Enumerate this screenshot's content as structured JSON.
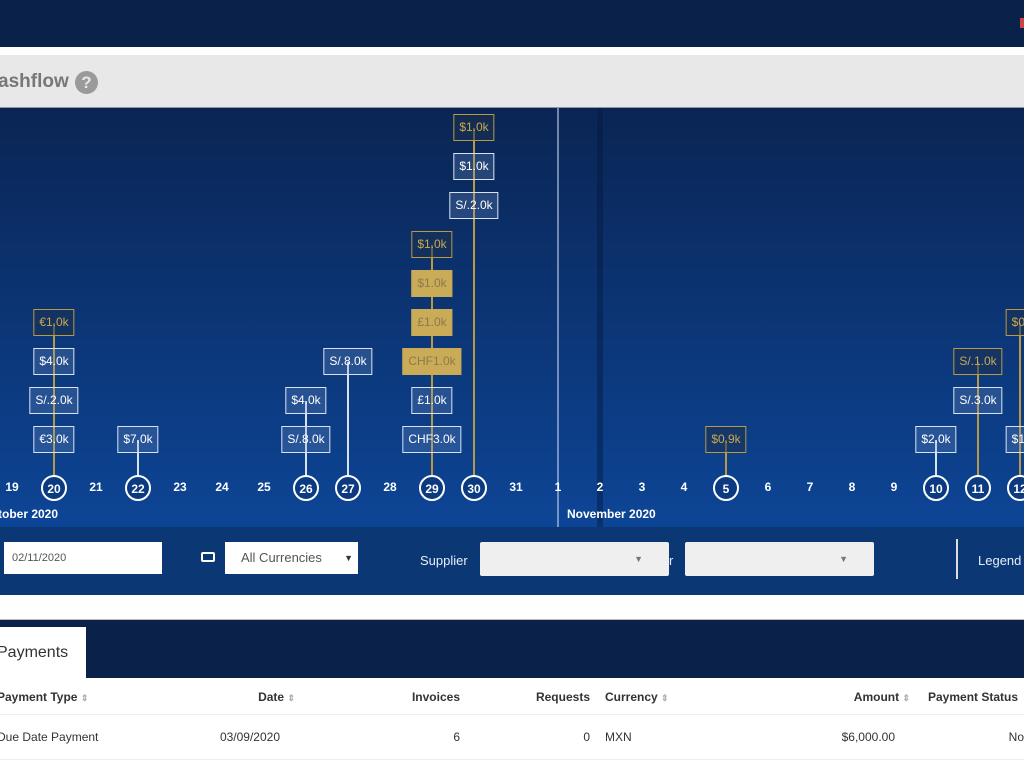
{
  "header": {
    "title": "ashflow",
    "help_icon": "?"
  },
  "colors": {
    "navy": "#0a2149",
    "gold": "#c9ab58",
    "filter_bg": "#0b3775"
  },
  "timeline": {
    "months": [
      {
        "label": "tober 2020"
      },
      {
        "label": "November 2020"
      }
    ],
    "days": [
      {
        "label": "19",
        "has": false
      },
      {
        "label": "20",
        "has": true
      },
      {
        "label": "21",
        "has": false
      },
      {
        "label": "22",
        "has": true
      },
      {
        "label": "23",
        "has": false
      },
      {
        "label": "24",
        "has": false
      },
      {
        "label": "25",
        "has": false
      },
      {
        "label": "26",
        "has": true
      },
      {
        "label": "27",
        "has": true
      },
      {
        "label": "28",
        "has": false
      },
      {
        "label": "29",
        "has": true
      },
      {
        "label": "30",
        "has": true
      },
      {
        "label": "31",
        "has": false
      },
      {
        "label": "1",
        "has": false
      },
      {
        "label": "2",
        "has": false
      },
      {
        "label": "3",
        "has": false
      },
      {
        "label": "4",
        "has": false
      },
      {
        "label": "5",
        "has": true
      },
      {
        "label": "6",
        "has": false
      },
      {
        "label": "7",
        "has": false
      },
      {
        "label": "8",
        "has": false
      },
      {
        "label": "9",
        "has": false
      },
      {
        "label": "10",
        "has": true
      },
      {
        "label": "11",
        "has": true
      },
      {
        "label": "12",
        "has": true
      }
    ],
    "entries": [
      {
        "day": 1,
        "row": 0,
        "label": "€3.0k",
        "style": "white"
      },
      {
        "day": 1,
        "row": 1,
        "label": "S/.2.0k",
        "style": "white"
      },
      {
        "day": 1,
        "row": 2,
        "label": "$4.0k",
        "style": "white"
      },
      {
        "day": 1,
        "row": 3,
        "label": "€1.0k",
        "style": "goldo"
      },
      {
        "day": 3,
        "row": 0,
        "label": "$7.0k",
        "style": "white"
      },
      {
        "day": 7,
        "row": 0,
        "label": "S/.8.0k",
        "style": "white"
      },
      {
        "day": 7,
        "row": 1,
        "label": "$4.0k",
        "style": "white"
      },
      {
        "day": 8,
        "row": 2,
        "label": "S/.8.0k",
        "style": "white"
      },
      {
        "day": 10,
        "row": 0,
        "label": "CHF3.0k",
        "style": "white"
      },
      {
        "day": 10,
        "row": 1,
        "label": "£1.0k",
        "style": "white"
      },
      {
        "day": 10,
        "row": 2,
        "label": "CHF1.0k",
        "style": "goldf"
      },
      {
        "day": 10,
        "row": 3,
        "label": "£1.0k",
        "style": "goldf"
      },
      {
        "day": 10,
        "row": 4,
        "label": "$1.0k",
        "style": "goldf"
      },
      {
        "day": 10,
        "row": 5,
        "label": "$1.0k",
        "style": "goldo"
      },
      {
        "day": 11,
        "row": 6,
        "label": "S/.2.0k",
        "style": "white"
      },
      {
        "day": 11,
        "row": 7,
        "label": "$1.0k",
        "style": "white"
      },
      {
        "day": 11,
        "row": 8,
        "label": "$1.0k",
        "style": "goldo"
      },
      {
        "day": 17,
        "row": 0,
        "label": "$0.9k",
        "style": "goldo"
      },
      {
        "day": 22,
        "row": 0,
        "label": "$2.0k",
        "style": "white"
      },
      {
        "day": 23,
        "row": 1,
        "label": "S/.3.0k",
        "style": "white"
      },
      {
        "day": 23,
        "row": 2,
        "label": "S/.1.0k",
        "style": "goldo"
      },
      {
        "day": 24,
        "row": 0,
        "label": "$1.",
        "style": "white"
      },
      {
        "day": 24,
        "row": 3,
        "label": "$0.",
        "style": "goldo"
      }
    ]
  },
  "filters": {
    "date": "02/11/2020",
    "currency_icon": "banknote",
    "currency": "All Currencies",
    "supplier_label": "Supplier",
    "second_label": "r",
    "legend": "Legend"
  },
  "tabs": {
    "payments": "Payments"
  },
  "table": {
    "columns": [
      "Payment Type",
      "Date",
      "Invoices",
      "Requests",
      "Currency",
      "Amount",
      "Payment Status"
    ],
    "rows": [
      {
        "type": "Due Date Payment",
        "date": "03/09/2020",
        "invoices": "6",
        "requests": "0",
        "currency": "MXN",
        "amount": "$6,000.00",
        "status": "No"
      }
    ]
  }
}
